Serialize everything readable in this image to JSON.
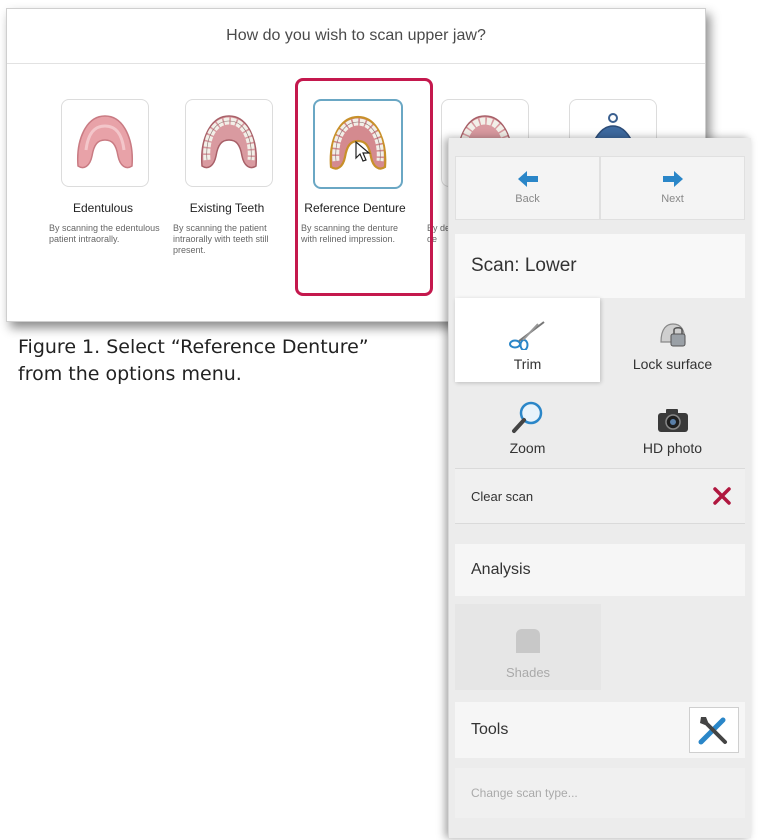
{
  "dialog": {
    "title": "How do you wish to scan upper jaw?",
    "options": [
      {
        "name": "Edentulous",
        "desc": "By scanning the edentulous patient intraorally."
      },
      {
        "name": "Existing Teeth",
        "desc": "By scanning the patient intraorally with teeth still present."
      },
      {
        "name": "Reference Denture",
        "desc": "By scanning the denture with relined impression."
      },
      {
        "name": "",
        "desc": "By de de"
      },
      {
        "name": "",
        "desc": ""
      }
    ],
    "highlight_color": "#c4184d"
  },
  "caption": "Figure 1. Select “Reference Denture” from the options menu.",
  "panel": {
    "nav": {
      "back": "Back",
      "next": "Next"
    },
    "scan_title": "Scan: Lower",
    "tools": {
      "trim": "Trim",
      "lock_surface": "Lock surface",
      "zoom": "Zoom",
      "hd_photo": "HD photo"
    },
    "clear_scan": "Clear scan",
    "analysis": "Analysis",
    "shades": "Shades",
    "tools_title": "Tools",
    "change_scan_type": "Change scan type..."
  }
}
